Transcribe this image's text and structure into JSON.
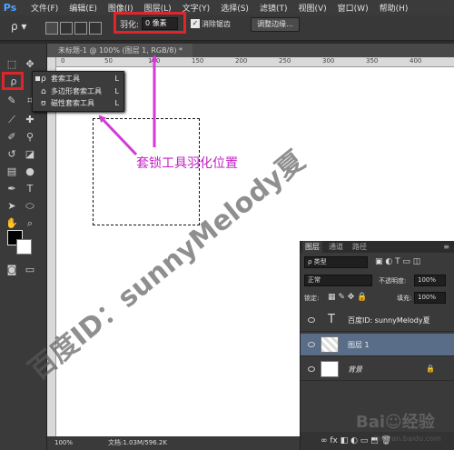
{
  "menubar": {
    "app_logo": "Ps",
    "items": [
      "文件(F)",
      "编辑(E)",
      "图像(I)",
      "图层(L)",
      "文字(Y)",
      "选择(S)",
      "滤镜(T)",
      "视图(V)",
      "窗口(W)",
      "帮助(H)"
    ]
  },
  "options": {
    "feather_label": "羽化:",
    "feather_value": "0 像素",
    "antialias_checked": "✓",
    "antialias_label": "消除锯齿",
    "refine_edge_label": "调整边缘..."
  },
  "flyout": {
    "items": [
      {
        "label": "套索工具",
        "key": "L",
        "icon": "lasso-icon",
        "selected": true
      },
      {
        "label": "多边形套索工具",
        "key": "L",
        "icon": "polygonal-lasso-icon",
        "selected": false
      },
      {
        "label": "磁性套索工具",
        "key": "L",
        "icon": "magnetic-lasso-icon",
        "selected": false
      }
    ]
  },
  "document": {
    "tab_title": "未标题-1 @ 100% (图层 1, RGB/8) *",
    "ruler_ticks": [
      "0",
      "50",
      "100",
      "150",
      "200",
      "250",
      "300",
      "350",
      "400"
    ],
    "zoom": "100%",
    "doc_info": "文档:1.03M/596.2K"
  },
  "annotation": {
    "text": "套锁工具羽化位置",
    "color": "#c41fc4"
  },
  "layers_panel": {
    "tabs": [
      "图层",
      "通道",
      "路径"
    ],
    "kind_filter": "ρ 类型",
    "blend_mode": "正常",
    "opacity_label": "不透明度:",
    "opacity_value": "100%",
    "lock_label": "锁定:",
    "fill_label": "填充:",
    "fill_value": "100%",
    "layers": [
      {
        "name": "百度ID: sunnyMelody夏",
        "type": "text",
        "thumb": "T"
      },
      {
        "name": "图层 1",
        "type": "pixel",
        "selected": true
      },
      {
        "name": "背景",
        "type": "background",
        "lock": "🔒"
      }
    ]
  },
  "watermark": {
    "text": "百度ID：sunnyMelody夏",
    "baidu_logo": "Bai☺经验",
    "baidu_url": "jingyan.baidu.com"
  },
  "colors": {
    "highlight_red": "#e2232a",
    "arrow_magenta": "#d23bd7",
    "selected_layer": "#596d89"
  }
}
